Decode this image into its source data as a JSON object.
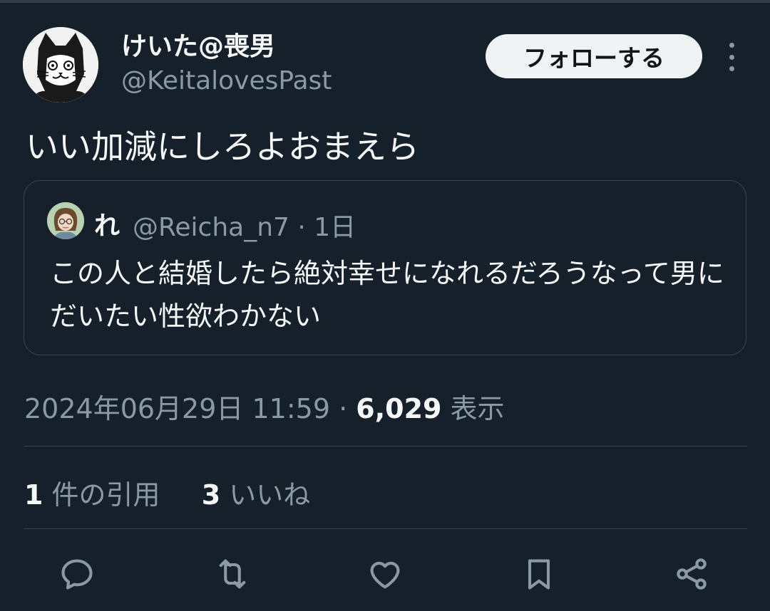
{
  "tweet": {
    "author": {
      "display_name": "けいた@喪男",
      "handle": "@KeitalovesPast"
    },
    "follow_label": "フォローする",
    "text": "いい加減にしろよおまえら",
    "quote": {
      "author_name": "れ",
      "handle": "@Reicha_n7 · 1日",
      "text": "この人と結婚したら絶対幸せになれるだろうなって男にだいたい性欲わかない"
    },
    "timestamp": "2024年06月29日 11:59 · ",
    "views_count": "6,029",
    "views_label": " 表示",
    "stats": {
      "quotes_count": "1",
      "quotes_label": " 件の引用",
      "likes_count": "3",
      "likes_label": " いいね"
    }
  },
  "icons": [
    "more-icon",
    "reply-icon",
    "retweet-icon",
    "like-icon",
    "bookmark-icon",
    "share-icon"
  ],
  "colors": {
    "background": "#15202b",
    "text": "#f7f9f9",
    "secondary": "#8b98a5",
    "border": "#38444d",
    "button_bg": "#eff3f4"
  }
}
